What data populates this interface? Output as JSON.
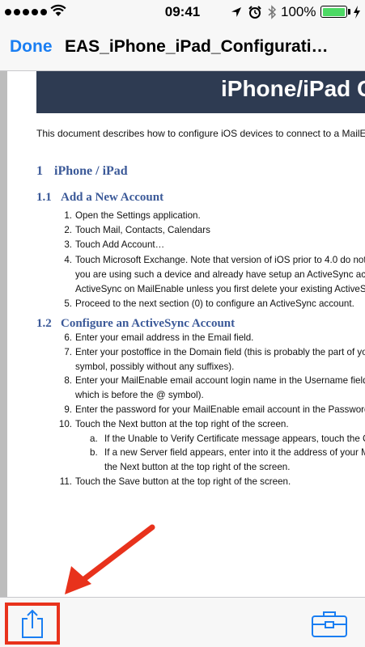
{
  "status_bar": {
    "time": "09:41",
    "battery_percent": "100%",
    "battery_level": 1.0,
    "icons": [
      "signal-dots-icon",
      "wifi-icon",
      "location-icon",
      "alarm-icon",
      "bluetooth-icon",
      "battery-icon",
      "charging-icon"
    ],
    "battery_color": "#4cd964"
  },
  "nav": {
    "done_label": "Done",
    "title": "EAS_iPhone_iPad_Configurati…",
    "accent_color": "#1a7ef2"
  },
  "document": {
    "banner_title": "iPhone/iPad Co",
    "intro": "This document describes how to configure iOS devices to connect to a MailEnab",
    "section1": {
      "num": "1",
      "title": "iPhone / iPad"
    },
    "section1_1": {
      "num": "1.1",
      "title": "Add a New Account"
    },
    "steps_1_1": [
      {
        "n": "1.",
        "text": "Open the Settings application."
      },
      {
        "n": "2.",
        "text": "Touch Mail, Contacts, Calendars"
      },
      {
        "n": "3.",
        "text": "Touch Add Account…"
      },
      {
        "n": "4.",
        "text": "Touch Microsoft Exchange. Note that version of iOS prior to 4.0 do not a"
      },
      {
        "n": "",
        "text": "you are using such a device and already have setup an ActiveSync accou"
      },
      {
        "n": "",
        "text": "ActiveSync on MailEnable unless you first delete your existing ActiveSyn"
      },
      {
        "n": "5.",
        "text": "Proceed to the next section (0) to configure an ActiveSync account."
      }
    ],
    "section1_2": {
      "num": "1.2",
      "title": "Configure an ActiveSync Account"
    },
    "steps_1_2": [
      {
        "n": "6.",
        "text": "Enter your email address in the Email field."
      },
      {
        "n": "7.",
        "text": "Enter your postoffice in the Domain field (this is probably the part of yo"
      },
      {
        "n": "",
        "text": "symbol, possibly without any suffixes)."
      },
      {
        "n": "8.",
        "text": "Enter your MailEnable email account login name in the Username field ("
      },
      {
        "n": "",
        "text": "which is before the @ symbol)."
      },
      {
        "n": "9.",
        "text": "Enter the password for your MailEnable email account in the Password"
      },
      {
        "n": "10.",
        "text": "Touch the Next button at the top right of the screen."
      },
      {
        "n": "a.",
        "text": "If the Unable to Verify Certificate message appears, touch the C"
      },
      {
        "n": "b.",
        "text": "If a new Server field appears, enter into it the address of your M"
      },
      {
        "n": "",
        "text": "the Next button at the top right of the screen."
      },
      {
        "n": "11.",
        "text": "Touch the Save button at the top right of the screen."
      }
    ],
    "banner_color": "#2e3b52",
    "heading_color": "#3b5998"
  },
  "toolbar": {
    "share_icon": "share-icon",
    "tools_icon": "toolbox-icon",
    "icon_color": "#1a7ef2",
    "highlight_color": "#e8321c"
  },
  "annotation": {
    "arrow_color": "#e8321c"
  }
}
